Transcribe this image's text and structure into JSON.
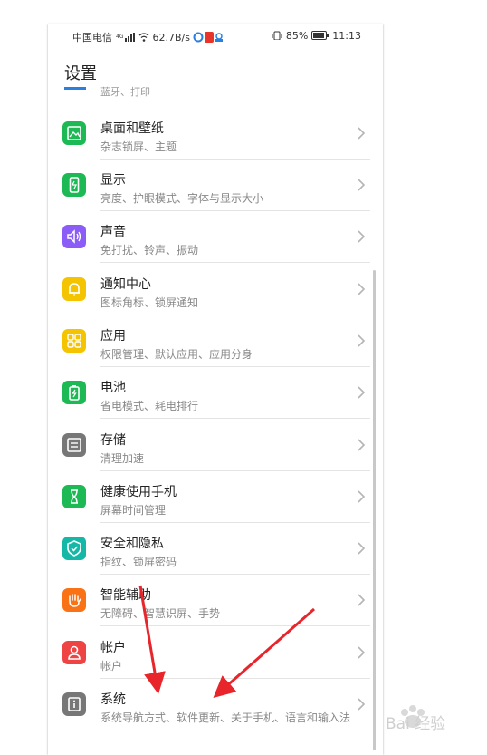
{
  "status_bar": {
    "carrier": "中国电信",
    "network_speed": "62.7B/s",
    "battery": "85%",
    "time": "11:13"
  },
  "header": {
    "title": "设置"
  },
  "partial_item": {
    "sub": "蓝牙、打印"
  },
  "items": [
    {
      "label": "桌面和壁纸",
      "sub": "杂志锁屏、主题",
      "color": "#1db954",
      "icon": "image-icon"
    },
    {
      "label": "显示",
      "sub": "亮度、护眼模式、字体与显示大小",
      "color": "#1db954",
      "icon": "display-icon"
    },
    {
      "label": "声音",
      "sub": "免打扰、铃声、振动",
      "color": "#8b5cf6",
      "icon": "speaker-icon"
    },
    {
      "label": "通知中心",
      "sub": "图标角标、锁屏通知",
      "color": "#f5c400",
      "icon": "bell-icon"
    },
    {
      "label": "应用",
      "sub": "权限管理、默认应用、应用分身",
      "color": "#f5c400",
      "icon": "apps-grid-icon"
    },
    {
      "label": "电池",
      "sub": "省电模式、耗电排行",
      "color": "#1db954",
      "icon": "battery-icon"
    },
    {
      "label": "存储",
      "sub": "清理加速",
      "color": "#777777",
      "icon": "storage-icon"
    },
    {
      "label": "健康使用手机",
      "sub": "屏幕时间管理",
      "color": "#1db954",
      "icon": "hourglass-icon"
    },
    {
      "label": "安全和隐私",
      "sub": "指纹、锁屏密码",
      "color": "#14b8a6",
      "icon": "shield-icon"
    },
    {
      "label": "智能辅助",
      "sub": "无障碍、智慧识屏、手势",
      "color": "#f97316",
      "icon": "hand-icon"
    },
    {
      "label": "帐户",
      "sub": "帐户",
      "color": "#ef4444",
      "icon": "user-icon"
    },
    {
      "label": "系统",
      "sub": "系统导航方式、软件更新、关于手机、语言和输入法",
      "color": "#777777",
      "icon": "info-icon"
    }
  ],
  "watermark": {
    "text": "Bai 经验"
  }
}
